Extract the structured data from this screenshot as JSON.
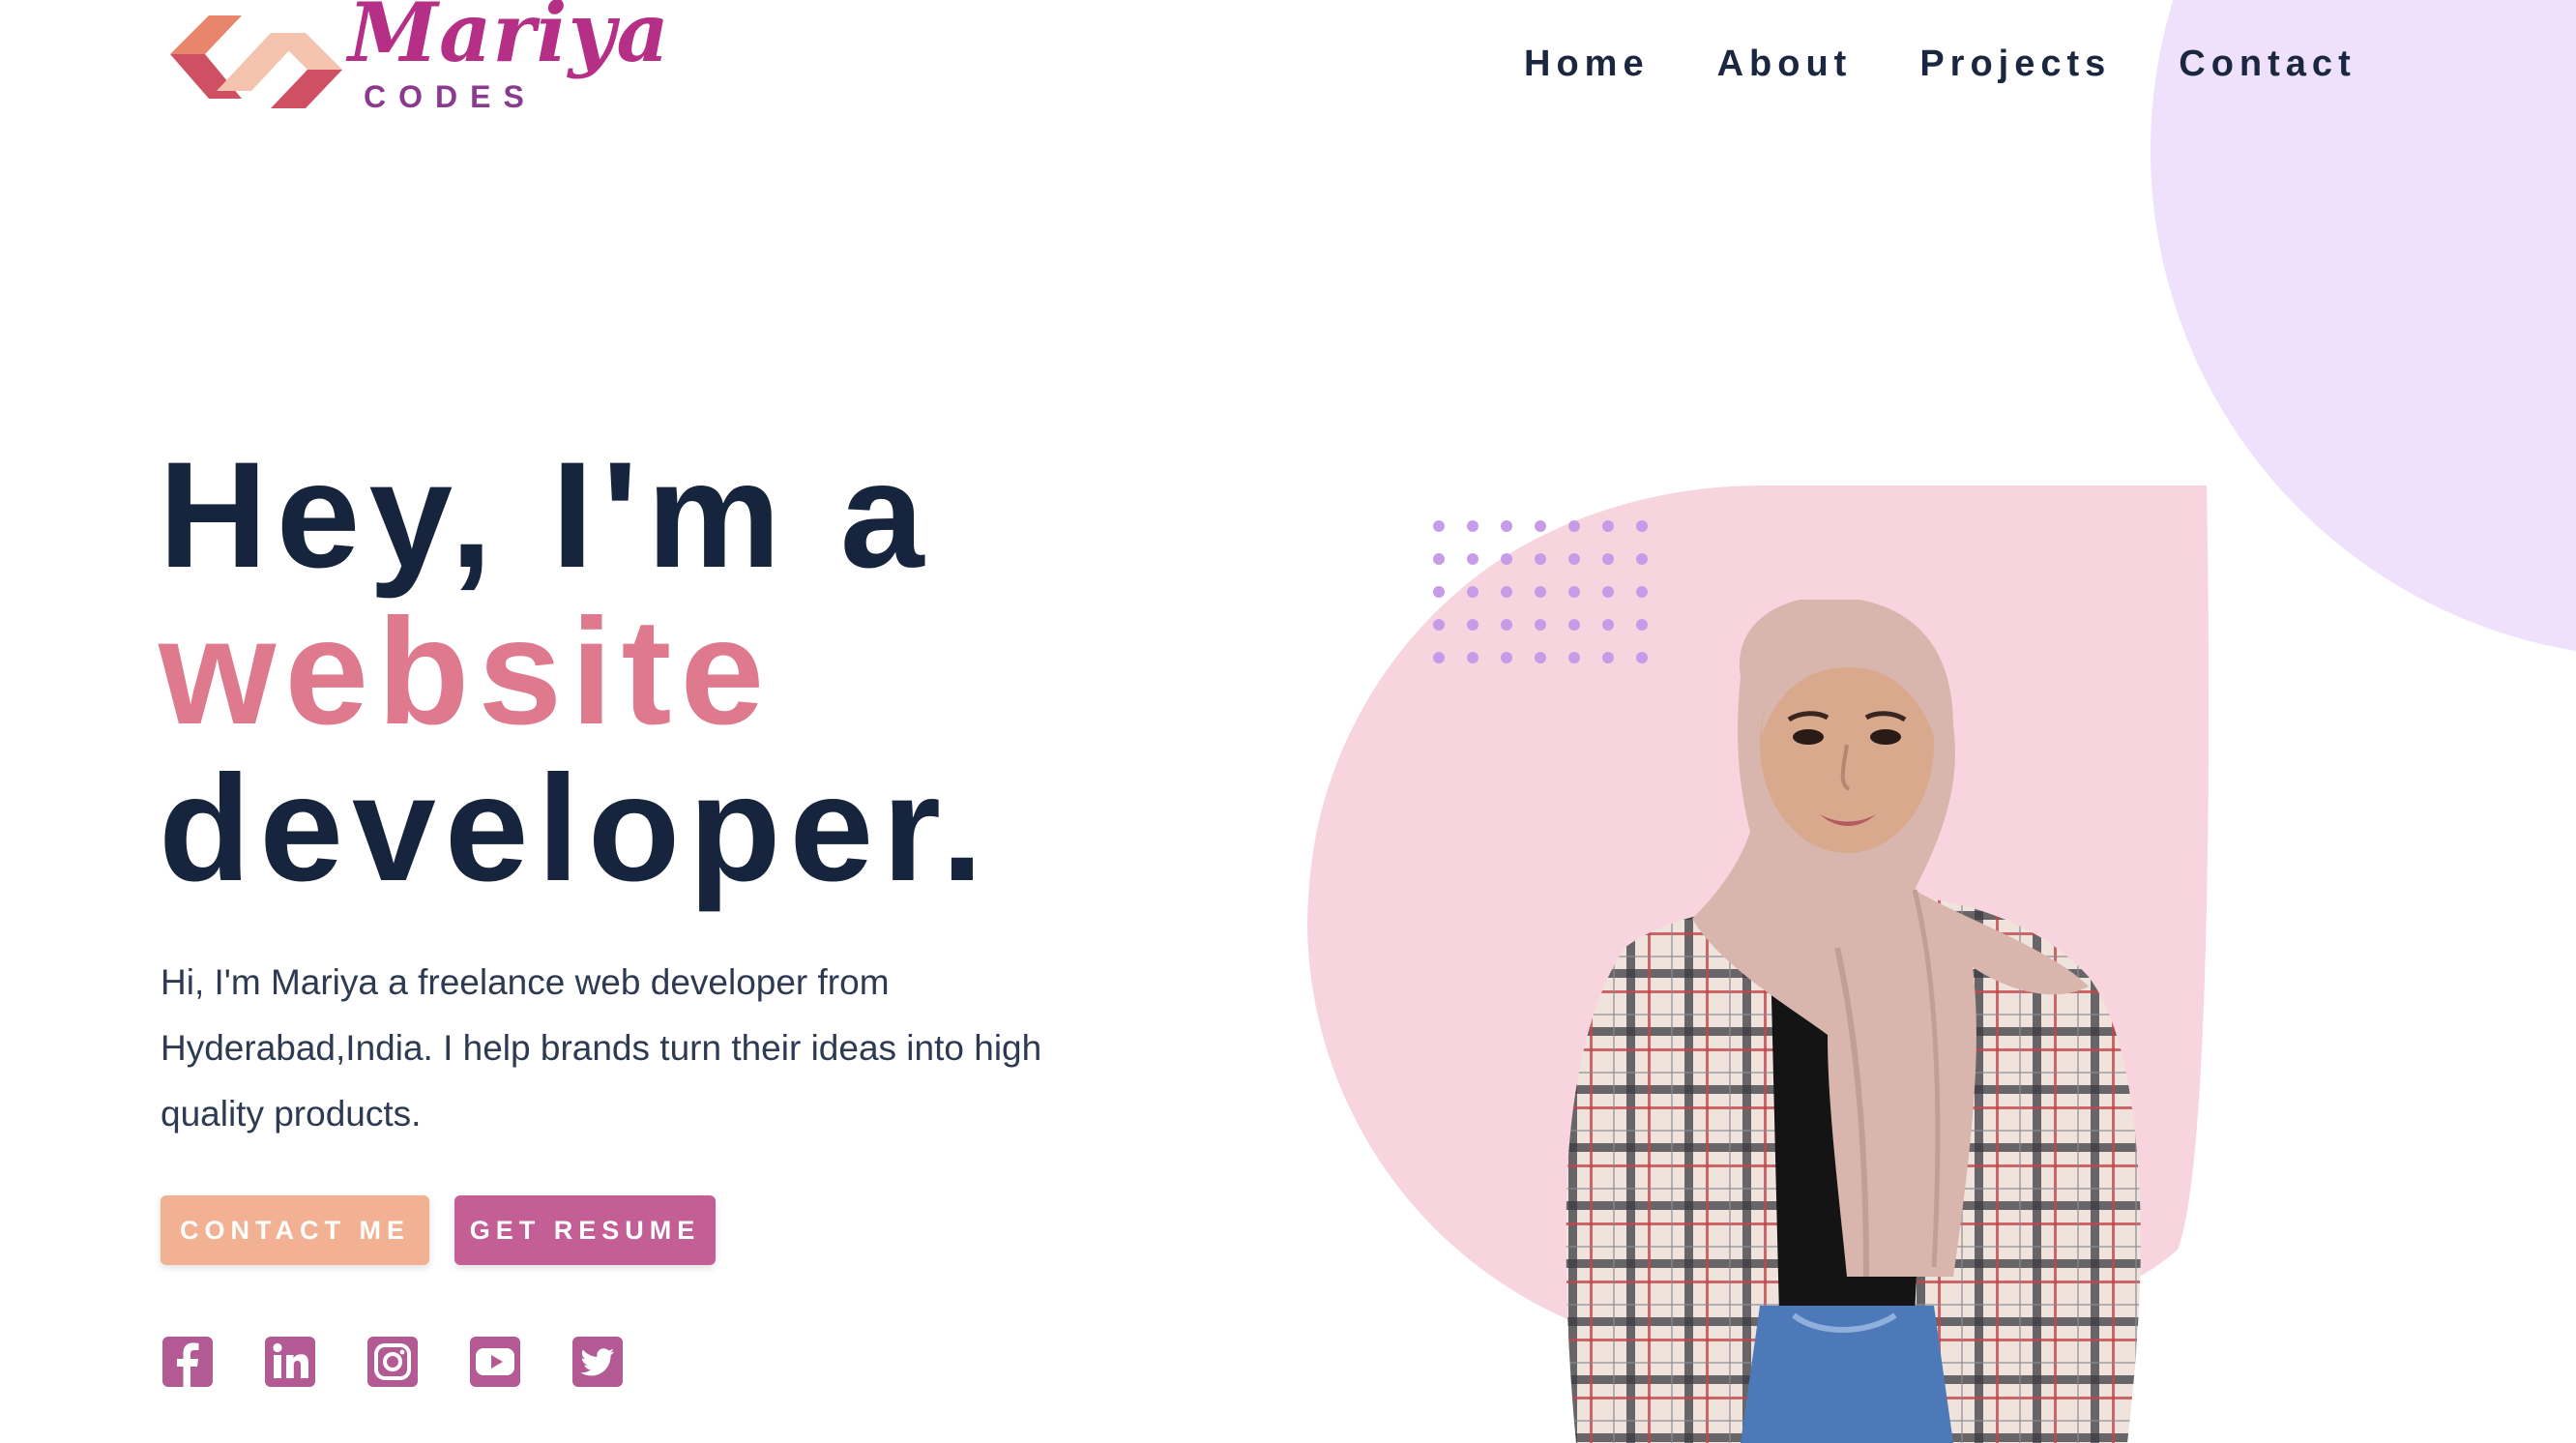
{
  "brand": {
    "name": "Mariya",
    "tagline": "CODES",
    "colors": {
      "logo_pink": "#b62f86",
      "logo_sub": "#8a3b8f",
      "mark_orange": "#e8856a",
      "mark_peach": "#f3c3ad",
      "mark_rose": "#cf4f63"
    }
  },
  "nav": {
    "items": [
      {
        "label": "Home"
      },
      {
        "label": "About"
      },
      {
        "label": "Projects"
      },
      {
        "label": "Contact"
      }
    ]
  },
  "hero": {
    "line1": "Hey, I'm a",
    "line2": "website",
    "line3": "developer.",
    "description": "Hi, I'm Mariya a freelance web developer from Hyderabad,India. I help brands turn their ideas into high quality products.",
    "buttons": {
      "contact": "CONTACT ME",
      "resume": "GET RESUME"
    }
  },
  "socials": [
    {
      "icon": "facebook-icon"
    },
    {
      "icon": "linkedin-icon"
    },
    {
      "icon": "instagram-icon"
    },
    {
      "icon": "youtube-icon"
    },
    {
      "icon": "twitter-icon"
    }
  ],
  "colors": {
    "heading": "#16243d",
    "accent": "#df7a8e",
    "button_contact": "#f2b193",
    "button_resume": "#c35f95",
    "social": "#b35a94",
    "blob": "#f8d5de",
    "circle": "#efe1fb",
    "dots": "#c89be9"
  }
}
